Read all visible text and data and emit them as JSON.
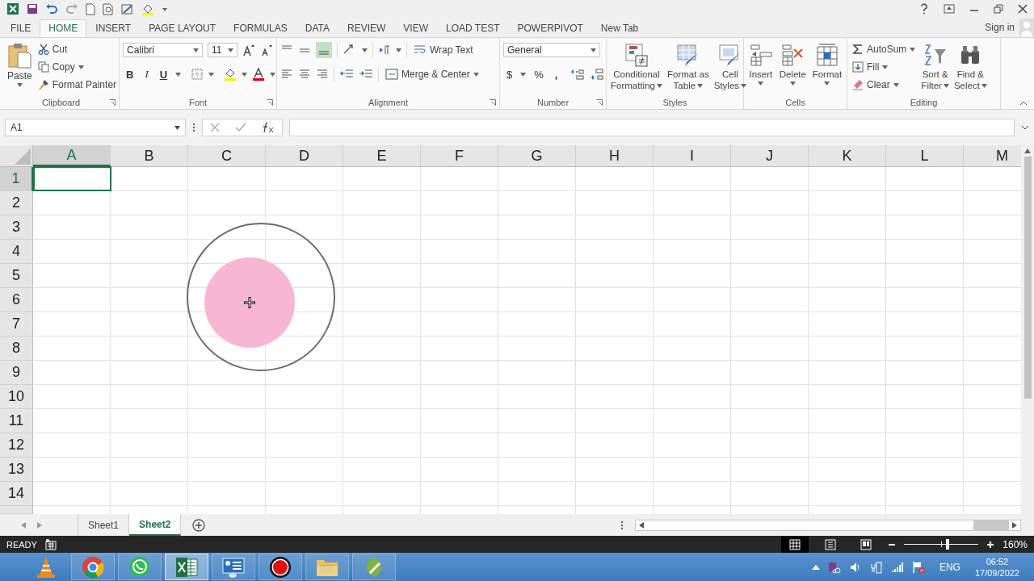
{
  "tabs": [
    {
      "label": "FILE",
      "selected": false
    },
    {
      "label": "HOME",
      "selected": true
    },
    {
      "label": "INSERT",
      "selected": false
    },
    {
      "label": "PAGE LAYOUT",
      "selected": false
    },
    {
      "label": "FORMULAS",
      "selected": false
    },
    {
      "label": "DATA",
      "selected": false
    },
    {
      "label": "REVIEW",
      "selected": false
    },
    {
      "label": "VIEW",
      "selected": false
    },
    {
      "label": "LOAD TEST",
      "selected": false
    },
    {
      "label": "POWERPIVOT",
      "selected": false
    },
    {
      "label": "New Tab",
      "selected": false
    }
  ],
  "sign_in": "Sign in",
  "ribbon": {
    "clipboard": {
      "label": "Clipboard",
      "paste": "Paste",
      "cut": "Cut",
      "copy": "Copy",
      "format_painter": "Format Painter"
    },
    "font": {
      "label": "Font",
      "font_name": "Calibri",
      "font_size": "11",
      "bold": "B",
      "italic": "I",
      "underline": "U"
    },
    "alignment": {
      "label": "Alignment",
      "wrap_text": "Wrap Text",
      "merge_center": "Merge & Center"
    },
    "number": {
      "label": "Number",
      "format": "General",
      "currency": "$",
      "percent": "%",
      "comma": ","
    },
    "styles": {
      "label": "Styles",
      "buttons": [
        {
          "kind": "conditional",
          "label": "Conditional\nFormatting"
        },
        {
          "kind": "table",
          "label": "Format as\nTable"
        },
        {
          "kind": "cellstyles",
          "label": "Cell\nStyles"
        }
      ]
    },
    "cells": {
      "label": "Cells",
      "buttons": [
        {
          "kind": "insert",
          "label": "Insert"
        },
        {
          "kind": "delete",
          "label": "Delete"
        },
        {
          "kind": "format",
          "label": "Format"
        }
      ]
    },
    "editing": {
      "label": "Editing",
      "autosum": "AutoSum",
      "fill": "Fill",
      "clear": "Clear",
      "sort_filter": "Sort &\nFilter",
      "find_select": "Find &\nSelect"
    }
  },
  "name_box": "A1",
  "columns": [
    {
      "label": "A",
      "selected": true
    },
    {
      "label": "B",
      "selected": false
    },
    {
      "label": "C",
      "selected": false
    },
    {
      "label": "D",
      "selected": false
    },
    {
      "label": "E",
      "selected": false
    },
    {
      "label": "F",
      "selected": false
    },
    {
      "label": "G",
      "selected": false
    },
    {
      "label": "H",
      "selected": false
    },
    {
      "label": "I",
      "selected": false
    },
    {
      "label": "J",
      "selected": false
    },
    {
      "label": "K",
      "selected": false
    },
    {
      "label": "L",
      "selected": false
    },
    {
      "label": "M",
      "selected": false
    }
  ],
  "rows": [
    {
      "label": "1",
      "selected": true
    },
    {
      "label": "2",
      "selected": false
    },
    {
      "label": "3",
      "selected": false
    },
    {
      "label": "4",
      "selected": false
    },
    {
      "label": "5",
      "selected": false
    },
    {
      "label": "6",
      "selected": false
    },
    {
      "label": "7",
      "selected": false
    },
    {
      "label": "8",
      "selected": false
    },
    {
      "label": "9",
      "selected": false
    },
    {
      "label": "10",
      "selected": false
    },
    {
      "label": "11",
      "selected": false
    },
    {
      "label": "12",
      "selected": false
    },
    {
      "label": "13",
      "selected": false
    },
    {
      "label": "14",
      "selected": false
    }
  ],
  "sheets": [
    {
      "label": "Sheet1",
      "selected": false
    },
    {
      "label": "Sheet2",
      "selected": true
    }
  ],
  "status": {
    "mode": "READY",
    "views": [
      {
        "kind": "normal",
        "selected": true
      },
      {
        "kind": "page_layout",
        "selected": false
      },
      {
        "kind": "page_break",
        "selected": false
      }
    ],
    "zoom": {
      "level": 0.58,
      "reading": "160%"
    }
  },
  "taskbar": {
    "apps": [
      {
        "kind": "vlc",
        "selected": false
      },
      {
        "kind": "chrome",
        "selected": false
      },
      {
        "kind": "whatsapp",
        "selected": false
      },
      {
        "kind": "excel",
        "selected": true
      },
      {
        "kind": "control",
        "selected": false
      },
      {
        "kind": "recorder",
        "selected": false
      },
      {
        "kind": "folder",
        "selected": false
      },
      {
        "kind": "pen",
        "selected": false
      }
    ],
    "language": "ENG",
    "time": "06:52",
    "date": "17/09/2022"
  }
}
